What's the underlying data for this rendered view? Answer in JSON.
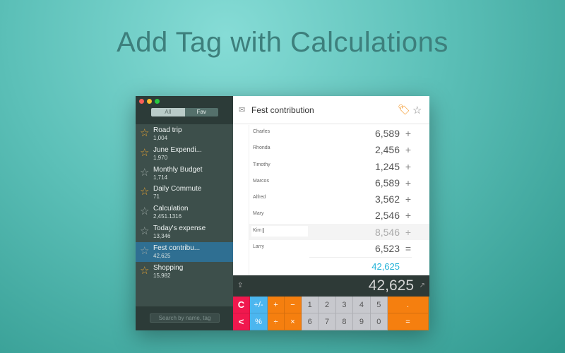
{
  "headline": "Add Tag with Calculations",
  "colors": {
    "accent": "#25b3d8",
    "tag": "#f39422",
    "selected": "#2f6f92",
    "clear": "#f0184e",
    "operator": "#f57f0f",
    "util": "#4cb6ef"
  },
  "sidebar": {
    "tabs": {
      "all": "All",
      "fav": "Fav"
    },
    "items": [
      {
        "name": "Road trip",
        "value": "1,004",
        "fav": true
      },
      {
        "name": "June Expendi...",
        "value": "1,970",
        "fav": true
      },
      {
        "name": "Monthly Budget",
        "value": "1,714",
        "fav": false
      },
      {
        "name": "Daily Commute",
        "value": "71",
        "fav": true
      },
      {
        "name": "Calculation",
        "value": "2,451.1316",
        "fav": false
      },
      {
        "name": "Today's expense",
        "value": "13,346",
        "fav": false
      },
      {
        "name": "Fest contribu...",
        "value": "42,625",
        "fav": false,
        "selected": true
      },
      {
        "name": "Shopping",
        "value": "15,982",
        "fav": true
      }
    ],
    "search_placeholder": "Search by name, tag"
  },
  "main": {
    "title": "Fest contribution",
    "rows": [
      {
        "name": "Charles",
        "value": "6,589",
        "op": "+"
      },
      {
        "name": "Rhonda",
        "value": "2,456",
        "op": "+"
      },
      {
        "name": "Timothy",
        "value": "1,245",
        "op": "+"
      },
      {
        "name": "Marcos",
        "value": "6,589",
        "op": "+"
      },
      {
        "name": "Alfred",
        "value": "3,562",
        "op": "+"
      },
      {
        "name": "Mary",
        "value": "2,546",
        "op": "+"
      },
      {
        "name": "Kim",
        "value": "8,546",
        "op": "+",
        "editing": true
      },
      {
        "name": "Larry",
        "value": "6,523",
        "op": "="
      }
    ],
    "total": "42,625"
  },
  "display": {
    "value": "42,625"
  },
  "keypad": {
    "row1": [
      "C",
      "+/-",
      "+",
      "−",
      "1",
      "2",
      "3",
      "4",
      "5",
      "."
    ],
    "row2": [
      "<",
      "%",
      "÷",
      "×",
      "6",
      "7",
      "8",
      "9",
      "0",
      "="
    ]
  }
}
